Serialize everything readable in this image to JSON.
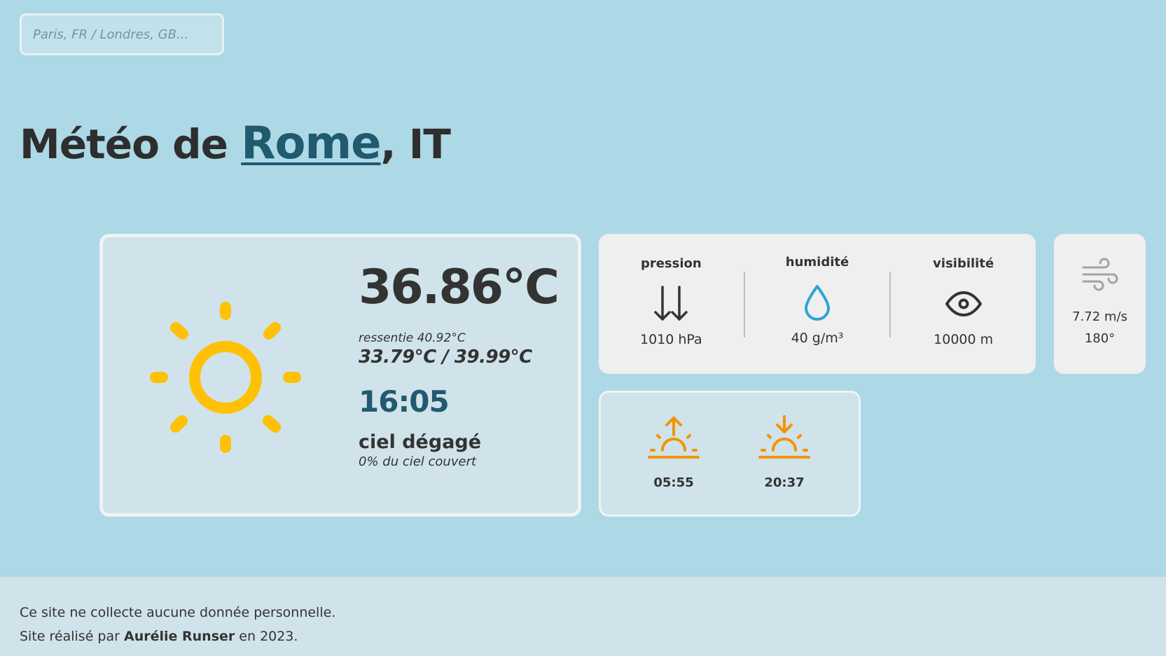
{
  "search": {
    "placeholder": "Paris, FR / Londres, GB..."
  },
  "title": {
    "prefix": "Météo de ",
    "city": "Rome",
    "country": ", IT"
  },
  "weather": {
    "icon": "sun-icon",
    "temperature": "36.86°C",
    "feels_like": "ressentie 40.92°C",
    "min_max": "33.79°C / 39.99°C",
    "time": "16:05",
    "description": "ciel dégagé",
    "clouds": "0% du ciel couvert"
  },
  "stats": {
    "pressure": {
      "label": "pression",
      "icon": "pressure-arrows-icon",
      "value": "1010 hPa"
    },
    "humidity": {
      "label": "humidité",
      "icon": "droplet-icon",
      "value": "40 g/m³"
    },
    "visibility": {
      "label": "visibilité",
      "icon": "eye-icon",
      "value": "10000 m"
    }
  },
  "wind": {
    "icon": "wind-icon",
    "speed": "7.72 m/s",
    "direction": "180°"
  },
  "sun_times": {
    "sunrise": {
      "icon": "sunrise-icon",
      "time": "05:55"
    },
    "sunset": {
      "icon": "sunset-icon",
      "time": "20:37"
    }
  },
  "footer": {
    "line1": "Ce site ne collecte aucune donnée personnelle.",
    "line2_prefix": "Site réalisé par ",
    "author": "Aurélie Runser",
    "line2_suffix": " en 2023."
  },
  "colors": {
    "background": "#add8e6",
    "card_light": "#d0e3ea",
    "card_grey": "#efefef",
    "accent_city": "#1f5a6e",
    "sun_yellow": "#ffc107",
    "sun_orange": "#f59300",
    "droplet_blue": "#2ba6d4"
  }
}
